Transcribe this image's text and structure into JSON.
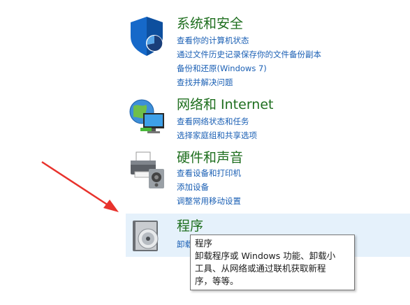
{
  "categories": [
    {
      "title": "系统和安全",
      "links": [
        "查看你的计算机状态",
        "通过文件历史记录保存你的文件备份副本",
        "备份和还原(Windows 7)",
        "查找并解决问题"
      ]
    },
    {
      "title": "网络和 Internet",
      "links": [
        "查看网络状态和任务",
        "选择家庭组和共享选项"
      ]
    },
    {
      "title": "硬件和声音",
      "links": [
        "查看设备和打印机",
        "添加设备",
        "调整常用移动设置"
      ]
    },
    {
      "title": "程序",
      "links": [
        "卸载"
      ]
    }
  ],
  "tooltip": {
    "title": "程序",
    "lines": [
      "卸载程序或 Windows 功能、卸载小",
      "工具、从网络或通过联机获取新程",
      "序，等等。"
    ]
  },
  "colors": {
    "title_green": "#1e6e1e",
    "link_blue": "#1a5fb4",
    "hover_bg": "#e5f1fb",
    "arrow_red": "#e8322c"
  }
}
